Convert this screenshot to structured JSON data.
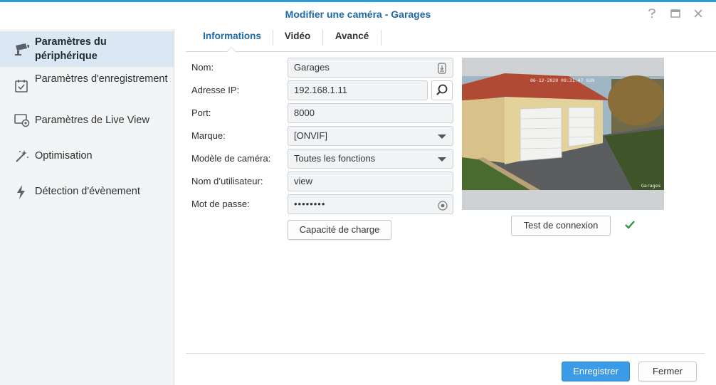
{
  "window": {
    "title": "Modifier une caméra - Garages",
    "controls": [
      "help-icon",
      "maximize-icon",
      "close-icon"
    ],
    "accent_color": "#2e9ad6"
  },
  "sidebar": {
    "items": [
      {
        "label": "Paramètres du périphérique",
        "icon": "camera-icon",
        "active": true
      },
      {
        "label": "Paramètres d'enregistrement",
        "icon": "calendar-check-icon",
        "active": false
      },
      {
        "label": "Paramètres de Live View",
        "icon": "monitor-eye-icon",
        "active": false
      },
      {
        "label": "Optimisation",
        "icon": "magic-wand-icon",
        "active": false
      },
      {
        "label": "Détection d'évènement",
        "icon": "lightning-icon",
        "active": false
      }
    ]
  },
  "tabs": [
    {
      "label": "Informations",
      "active": true
    },
    {
      "label": "Vidéo",
      "active": false
    },
    {
      "label": "Avancé",
      "active": false
    }
  ],
  "form": {
    "name": {
      "label": "Nom:",
      "value": "Garages"
    },
    "ip": {
      "label": "Adresse IP:",
      "value": "192.168.1.11"
    },
    "port": {
      "label": "Port:",
      "value": "8000"
    },
    "brand": {
      "label": "Marque:",
      "value": "[ONVIF]"
    },
    "model": {
      "label": "Modèle de caméra:",
      "value": "Toutes les fonctions"
    },
    "username": {
      "label": "Nom d’utilisateur:",
      "value": "view"
    },
    "password": {
      "label": "Mot de passe:",
      "value": "••••••••"
    }
  },
  "buttons": {
    "capacity": "Capacité de charge",
    "test_connection": "Test de connexion",
    "save": "Enregistrer",
    "close": "Fermer"
  },
  "preview": {
    "timestamp": "06-12-2020 09:31:47 SUN",
    "camera_label": "Garages"
  },
  "status": {
    "connection_ok_icon": "checkmark-icon",
    "ok_color": "#2a9d3a"
  }
}
